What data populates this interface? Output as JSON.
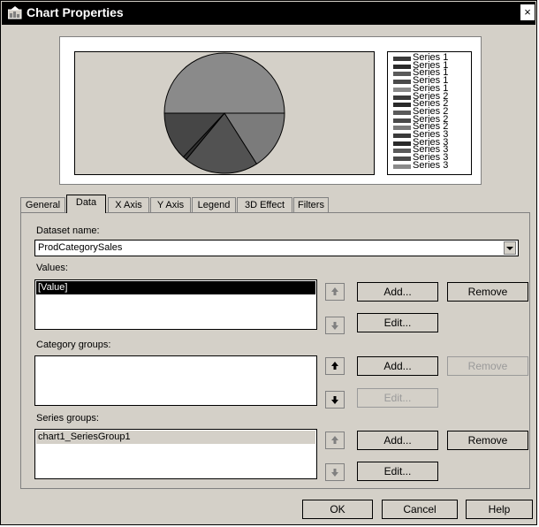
{
  "window": {
    "title": "Chart Properties",
    "close_label": "×"
  },
  "chart_data": {
    "type": "pie",
    "values": [
      50,
      16,
      20,
      1,
      13
    ],
    "colors": [
      "#8a8a8a",
      "#7b7b7b",
      "#525252",
      "#2f2f2f",
      "#464646"
    ],
    "legend": {
      "position": "right",
      "entries": [
        "Series 1",
        "Series 1",
        "Series 1",
        "Series 1",
        "Series 1",
        "Series 2",
        "Series 2",
        "Series 2",
        "Series 2",
        "Series 2",
        "Series 3",
        "Series 3",
        "Series 3",
        "Series 3",
        "Series 3"
      ],
      "colors": [
        "#3a3a3a",
        "#2a2a2a",
        "#5a5a5a",
        "#4a4a4a",
        "#8a8a8a",
        "#3a3a3a",
        "#2a2a2a",
        "#5a5a5a",
        "#4a4a4a",
        "#7a7a7a",
        "#3a3a3a",
        "#2a2a2a",
        "#5a5a5a",
        "#4a4a4a",
        "#8a8a8a"
      ]
    }
  },
  "tabs": [
    "General",
    "Data",
    "X Axis",
    "Y Axis",
    "Legend",
    "3D Effect",
    "Filters"
  ],
  "active_tab": "Data",
  "data_tab": {
    "dataset_label": "Dataset name:",
    "dataset_value": "ProdCategorySales",
    "values_label": "Values:",
    "values_items": [
      "[Value]"
    ],
    "category_label": "Category groups:",
    "series_label": "Series groups:",
    "series_items": [
      "chart1_SeriesGroup1"
    ],
    "add_label": "Add...",
    "edit_label": "Edit...",
    "remove_label": "Remove"
  },
  "footer": {
    "ok_label": "OK",
    "cancel_label": "Cancel",
    "help_label": "Help"
  }
}
